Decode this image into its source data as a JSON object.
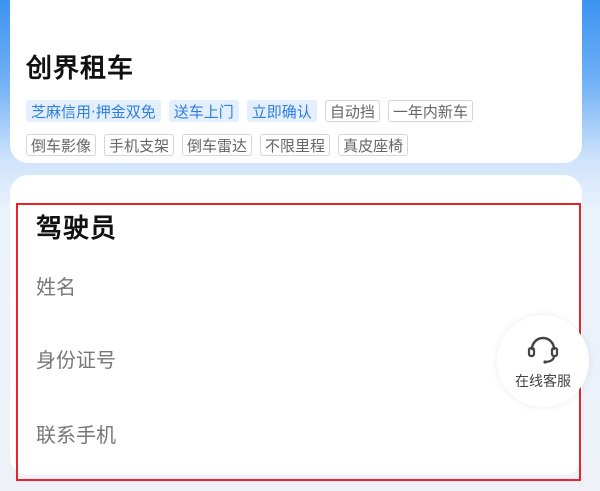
{
  "vendor": {
    "name": "创界租车",
    "tags_row1": [
      {
        "label": "芝麻信用·押金双免",
        "style": "highlight"
      },
      {
        "label": "送车上门",
        "style": "highlight"
      },
      {
        "label": "立即确认",
        "style": "highlight"
      },
      {
        "label": "自动挡",
        "style": "plain"
      },
      {
        "label": "一年内新车",
        "style": "plain"
      }
    ],
    "tags_row2": [
      {
        "label": "倒车影像",
        "style": "plain"
      },
      {
        "label": "手机支架",
        "style": "plain"
      },
      {
        "label": "倒车雷达",
        "style": "plain"
      },
      {
        "label": "不限里程",
        "style": "plain"
      },
      {
        "label": "真皮座椅",
        "style": "plain"
      }
    ]
  },
  "driver": {
    "title": "驾驶员",
    "fields": {
      "name_placeholder": "姓名",
      "id_placeholder": "身份证号",
      "phone_placeholder": "联系手机"
    }
  },
  "service": {
    "label": "在线客服",
    "icon": "headset-icon"
  },
  "colors": {
    "highlight_tag_bg": "#e3effd",
    "highlight_tag_text": "#2f7fe0",
    "selection_outline": "#e8232d"
  }
}
